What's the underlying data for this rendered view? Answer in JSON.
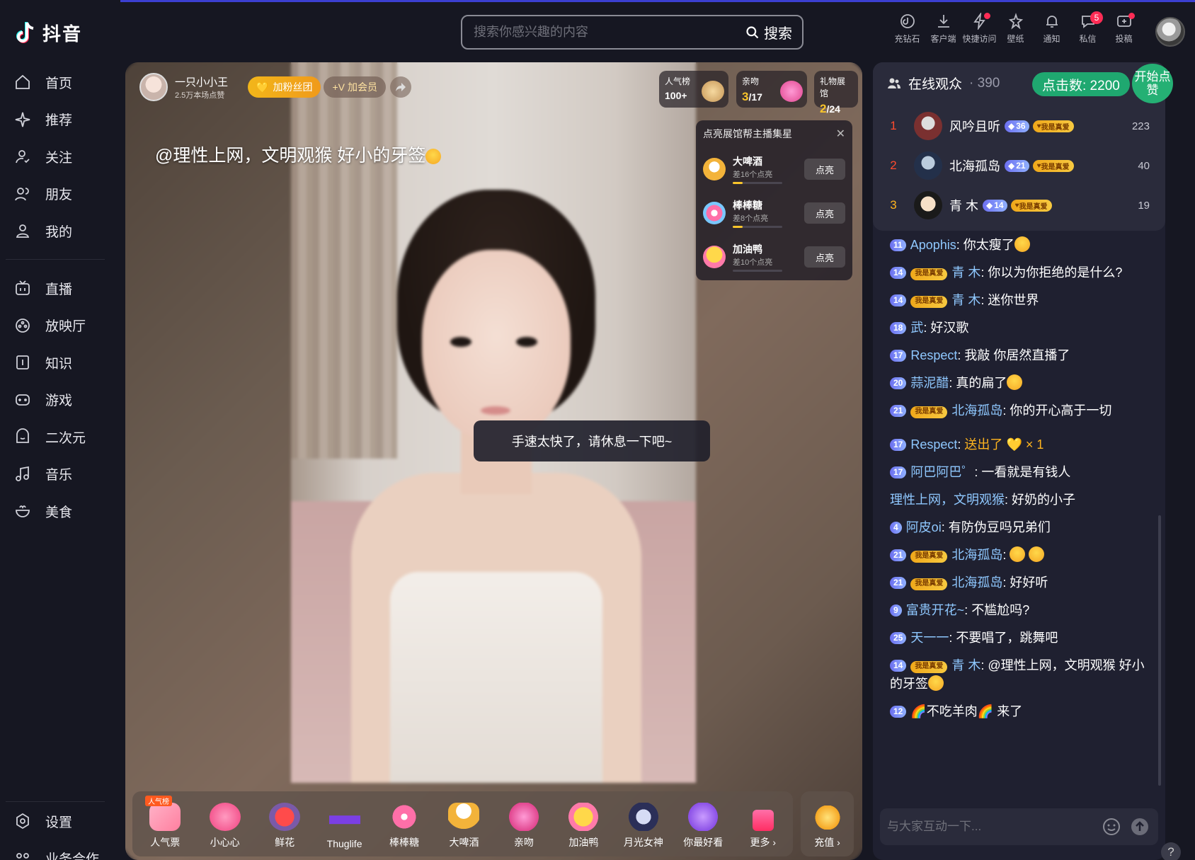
{
  "app": {
    "name": "抖音"
  },
  "sidebar": {
    "items": [
      {
        "label": "首页",
        "icon": "home-icon"
      },
      {
        "label": "推荐",
        "icon": "sparkle-icon"
      },
      {
        "label": "关注",
        "icon": "follow-icon"
      },
      {
        "label": "朋友",
        "icon": "friends-icon"
      },
      {
        "label": "我的",
        "icon": "user-icon"
      }
    ],
    "items2": [
      {
        "label": "直播",
        "icon": "live-tv-icon"
      },
      {
        "label": "放映厅",
        "icon": "film-reel-icon"
      },
      {
        "label": "知识",
        "icon": "book-icon"
      },
      {
        "label": "游戏",
        "icon": "gamepad-icon"
      },
      {
        "label": "二次元",
        "icon": "anime-icon"
      },
      {
        "label": "音乐",
        "icon": "music-note-icon"
      },
      {
        "label": "美食",
        "icon": "food-icon"
      }
    ],
    "settings": "设置",
    "business": "业务合作"
  },
  "header": {
    "search_placeholder": "搜索你感兴趣的内容",
    "search_button": "搜索",
    "tools": [
      {
        "label": "充钻石",
        "icon": "diamond-icon"
      },
      {
        "label": "客户端",
        "icon": "download-icon"
      },
      {
        "label": "快捷访问",
        "icon": "lightning-icon"
      },
      {
        "label": "壁纸",
        "icon": "wallpaper-icon"
      },
      {
        "label": "通知",
        "icon": "bell-icon"
      },
      {
        "label": "私信",
        "icon": "message-icon",
        "badge": "5"
      },
      {
        "label": "投稿",
        "icon": "upload-icon"
      }
    ]
  },
  "stream": {
    "host_name": "一只小小王",
    "host_likes": "2.5万本场点赞",
    "fan_club_button": "加粉丝团",
    "vip_button": "加会员",
    "danmu": "@理性上网，文明观猴 好小的牙签",
    "popularity": {
      "title": "人气榜",
      "value": "100+"
    },
    "kiss": {
      "title": "亲吻",
      "current": "3",
      "total": "/17"
    },
    "gallery": {
      "title": "礼物展馆",
      "current": "2",
      "total": "/24"
    },
    "toast": "手速太快了，请休息一下吧~",
    "lightup": {
      "title": "点亮展馆帮主播集星",
      "items": [
        {
          "name": "大啤酒",
          "need": "差16个点亮",
          "button": "点亮",
          "progress": 0.2
        },
        {
          "name": "棒棒糖",
          "need": "差8个点亮",
          "button": "点亮",
          "progress": 0.2
        },
        {
          "name": "加油鸭",
          "need": "差10个点亮",
          "button": "点亮",
          "progress": 0.0
        }
      ]
    },
    "gifts": [
      {
        "label": "人气票",
        "tag": "人气榜"
      },
      {
        "label": "小心心"
      },
      {
        "label": "鲜花"
      },
      {
        "label": "Thuglife"
      },
      {
        "label": "棒棒糖"
      },
      {
        "label": "大啤酒"
      },
      {
        "label": "亲吻"
      },
      {
        "label": "加油鸭"
      },
      {
        "label": "月光女神"
      },
      {
        "label": "你最好看"
      },
      {
        "label": "更多 ›"
      }
    ],
    "recharge": "充值 ›"
  },
  "panel": {
    "title": "在线观众",
    "count": "· 390",
    "click_count": "点击数: 2200",
    "start_button": "开始点赞",
    "viewers": [
      {
        "rank": "1",
        "name": "风吟且听",
        "level": "36",
        "fan": "我是真爱",
        "score": "223"
      },
      {
        "rank": "2",
        "name": "北海孤岛",
        "level": "21",
        "fan": "我是真爱",
        "score": "40"
      },
      {
        "rank": "3",
        "name": "青 木",
        "level": "14",
        "fan": "我是真爱",
        "score": "19"
      }
    ],
    "chat": [
      {
        "level": "11",
        "user": "Apophis",
        "text": "你太瘦了"
      },
      {
        "level": "14",
        "fan": "我是真爱",
        "user": "青 木",
        "text": "你以为你拒绝的是什么?"
      },
      {
        "level": "14",
        "fan": "我是真爱",
        "user": "青 木",
        "text": "迷你世界"
      },
      {
        "level": "18",
        "user": "武",
        "text": "好汉歌"
      },
      {
        "level": "17",
        "user": "Respect",
        "text": "我敲 你居然直播了"
      },
      {
        "level": "20",
        "user": "蒜泥醋",
        "text": "真的扁了"
      },
      {
        "level": "21",
        "fan": "我是真爱",
        "user": "北海孤岛",
        "text": "你的开心高于一切"
      },
      {
        "level": "17",
        "user": "Respect",
        "text": "送出了",
        "gift_count": "× 1"
      },
      {
        "level": "17",
        "user": "阿巴阿巴゜",
        "text": "一看就是有钱人"
      },
      {
        "user": "理性上网，文明观猴",
        "text": "好奶的小子"
      },
      {
        "level": "4",
        "user": "阿皮oi",
        "text": "有防伪豆吗兄弟们"
      },
      {
        "level": "21",
        "fan": "我是真爱",
        "user": "北海孤岛",
        "text": ""
      },
      {
        "level": "21",
        "fan": "我是真爱",
        "user": "北海孤岛",
        "text": "好好听"
      },
      {
        "level": "9",
        "user": "富贵开花~",
        "text": "不尴尬吗?"
      },
      {
        "level": "25",
        "user": "天一一",
        "text": "不要唱了，跳舞吧"
      },
      {
        "level": "14",
        "fan": "我是真爱",
        "user": "青 木",
        "text": "@理性上网，文明观猴 好小的牙签"
      },
      {
        "level": "12",
        "user": "🌈不吃羊肉🌈",
        "text": "来了"
      }
    ],
    "input_placeholder": "与大家互动一下..."
  }
}
